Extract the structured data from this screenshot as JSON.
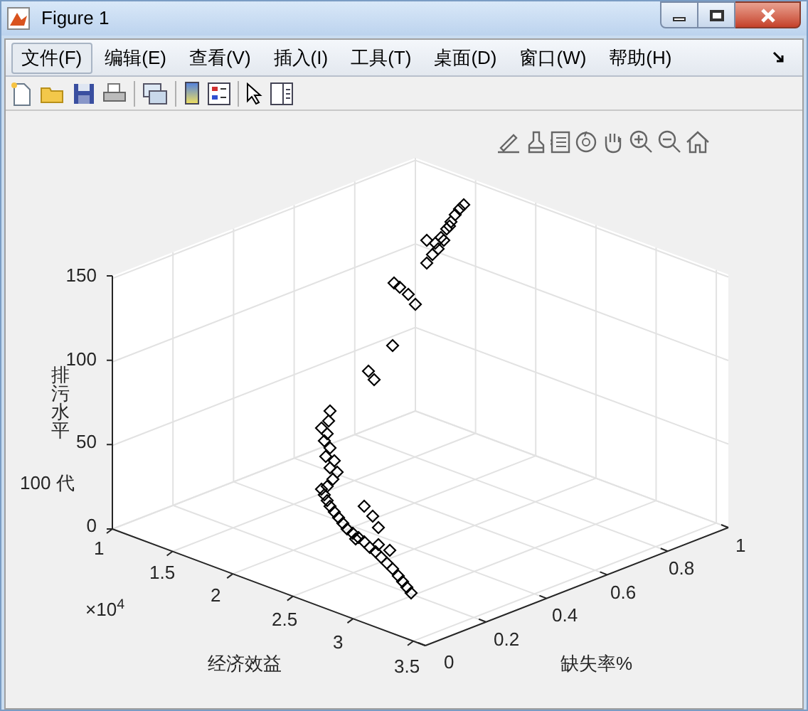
{
  "window": {
    "title": "Figure 1"
  },
  "menu": [
    {
      "label": "文件(F)",
      "selected": true
    },
    {
      "label": "编辑(E)",
      "selected": false
    },
    {
      "label": "查看(V)",
      "selected": false
    },
    {
      "label": "插入(I)",
      "selected": false
    },
    {
      "label": "工具(T)",
      "selected": false
    },
    {
      "label": "桌面(D)",
      "selected": false
    },
    {
      "label": "窗口(W)",
      "selected": false
    },
    {
      "label": "帮助(H)",
      "selected": false
    }
  ],
  "plot": {
    "annotation": "100 代",
    "zlabel": "排污水平",
    "xlabel": "经济效益",
    "ylabel": "缺失率%",
    "x_multiplier": "×10$^{4}$",
    "xticks": [
      "1",
      "1.5",
      "2",
      "2.5",
      "3",
      "3.5"
    ],
    "yticks": [
      "0",
      "0.2",
      "0.4",
      "0.6",
      "0.8",
      "1"
    ],
    "zticks": [
      "150",
      "100",
      "50",
      "0"
    ]
  }
}
